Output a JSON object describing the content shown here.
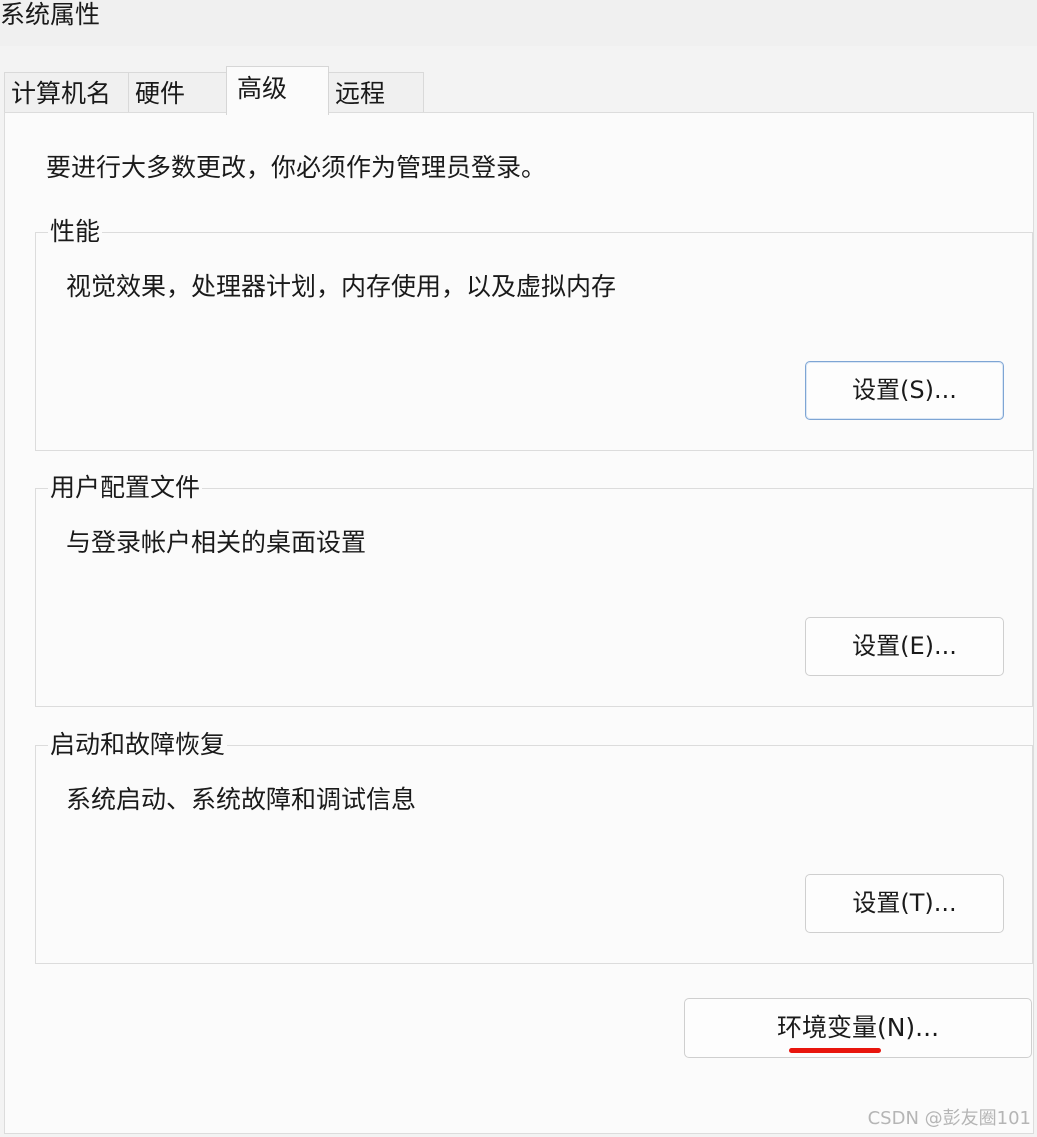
{
  "window": {
    "title": "系统属性"
  },
  "tabs": [
    {
      "label": "计算机名",
      "active": false
    },
    {
      "label": "硬件",
      "active": false
    },
    {
      "label": "高级",
      "active": true
    },
    {
      "label": "远程",
      "active": false
    }
  ],
  "intro": "要进行大多数更改，你必须作为管理员登录。",
  "groups": {
    "performance": {
      "label": "性能",
      "description": "视觉效果，处理器计划，内存使用，以及虚拟内存",
      "button": "设置(S)..."
    },
    "user_profiles": {
      "label": "用户配置文件",
      "description": "与登录帐户相关的桌面设置",
      "button": "设置(E)..."
    },
    "startup_recovery": {
      "label": "启动和故障恢复",
      "description": "系统启动、系统故障和调试信息",
      "button": "设置(T)..."
    }
  },
  "environment_button": "环境变量(N)...",
  "watermark": "CSDN @彭友圈101",
  "colors": {
    "annotation_underline": "#e8150d",
    "focus_border": "#7ea5d4"
  }
}
